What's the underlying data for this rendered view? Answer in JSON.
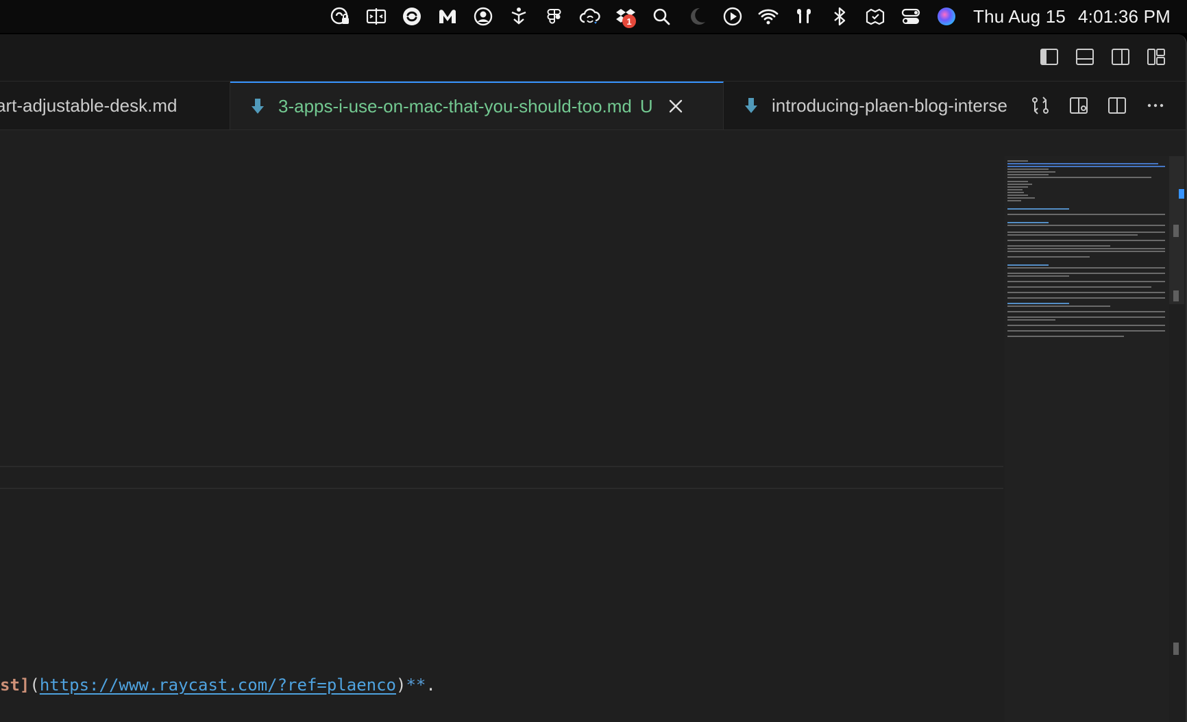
{
  "menubar": {
    "date": "Thu Aug 15",
    "time": "4:01:36 PM",
    "notification_badge": "1",
    "icons": [
      "password-lock-icon",
      "split-view-icon",
      "sync-icon",
      "malwarebytes-icon",
      "user-circle-icon",
      "drone-icon",
      "figma-icon",
      "cloud-sync-icon",
      "dropbox-icon",
      "search-icon",
      "moon-icon",
      "play-icon",
      "wifi-icon",
      "airpods-icon",
      "bluetooth-icon",
      "sparkle-folder-icon",
      "control-center-icon",
      "siri-icon"
    ]
  },
  "tabs": [
    {
      "label": "art-adjustable-desk.md",
      "active": false
    },
    {
      "label": "3-apps-i-use-on-mac-that-you-should-too.md",
      "modified": "U",
      "active": true
    },
    {
      "label": "introducing-plaen-blog-interse",
      "active": false
    }
  ],
  "editor": {
    "line": {
      "bracket": "st]",
      "open_paren": "(",
      "url": "https://www.raycast.com/?ref=plaenco",
      "close_paren": ")",
      "bold_marker": "**",
      "dot": "."
    }
  },
  "colors": {
    "accent": "#3794ff",
    "modified_green": "#73c991",
    "editor_bg": "#1f1f1f",
    "tab_bg": "#181818",
    "link_blue": "#4fa3e0",
    "bracket_orange": "#ce9178"
  }
}
